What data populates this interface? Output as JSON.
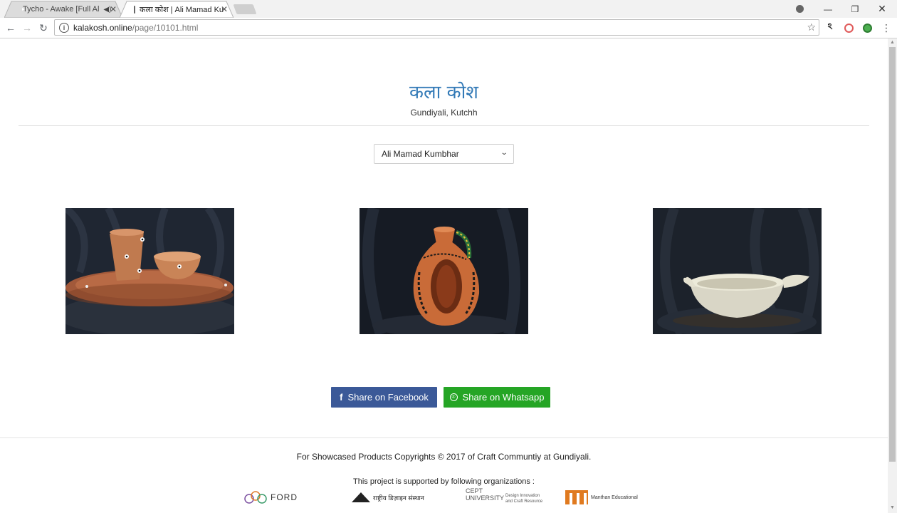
{
  "browser": {
    "tabs": [
      {
        "title": "Tycho - Awake [Full Al",
        "favicon": "youtube-icon",
        "audio": true
      },
      {
        "title": "कला कोश | Ali Mamad Ku",
        "favicon": "page-icon",
        "active": true
      }
    ],
    "url_host": "kalakosh.online",
    "url_path": "/page/10101.html"
  },
  "site": {
    "title": "कला कोश",
    "subtitle": "Gundiyali, Kutchh"
  },
  "artisan_select": {
    "selected": "Ali Mamad Kumbhar"
  },
  "products": [
    {
      "name": "terracotta-cup-bowl-plate"
    },
    {
      "name": "painted-terracotta-flask"
    },
    {
      "name": "white-clay-bowl"
    }
  ],
  "share": {
    "facebook_label": "Share on Facebook",
    "whatsapp_label": "Share on Whatsapp",
    "facebook_color": "#3b5998",
    "whatsapp_color": "#25a525"
  },
  "footer": {
    "copyright": "For Showcased Products Copyrights © 2017 of Craft Communtiy at Gundiyali.",
    "support_text": "This project is supported by following organizations :",
    "logos": [
      {
        "name": "ford-foundation-logo",
        "text": "FORD"
      },
      {
        "name": "nid-logo",
        "text": "राष्ट्रीय डिज़ाइन संस्थान"
      },
      {
        "name": "cept-logo",
        "text": "CEPT UNIVERSITY",
        "sub": "Design Innovation and Craft Resource"
      },
      {
        "name": "manthan-logo",
        "text": "Manthan Educational"
      }
    ]
  },
  "colors": {
    "accent": "#337ab7"
  }
}
